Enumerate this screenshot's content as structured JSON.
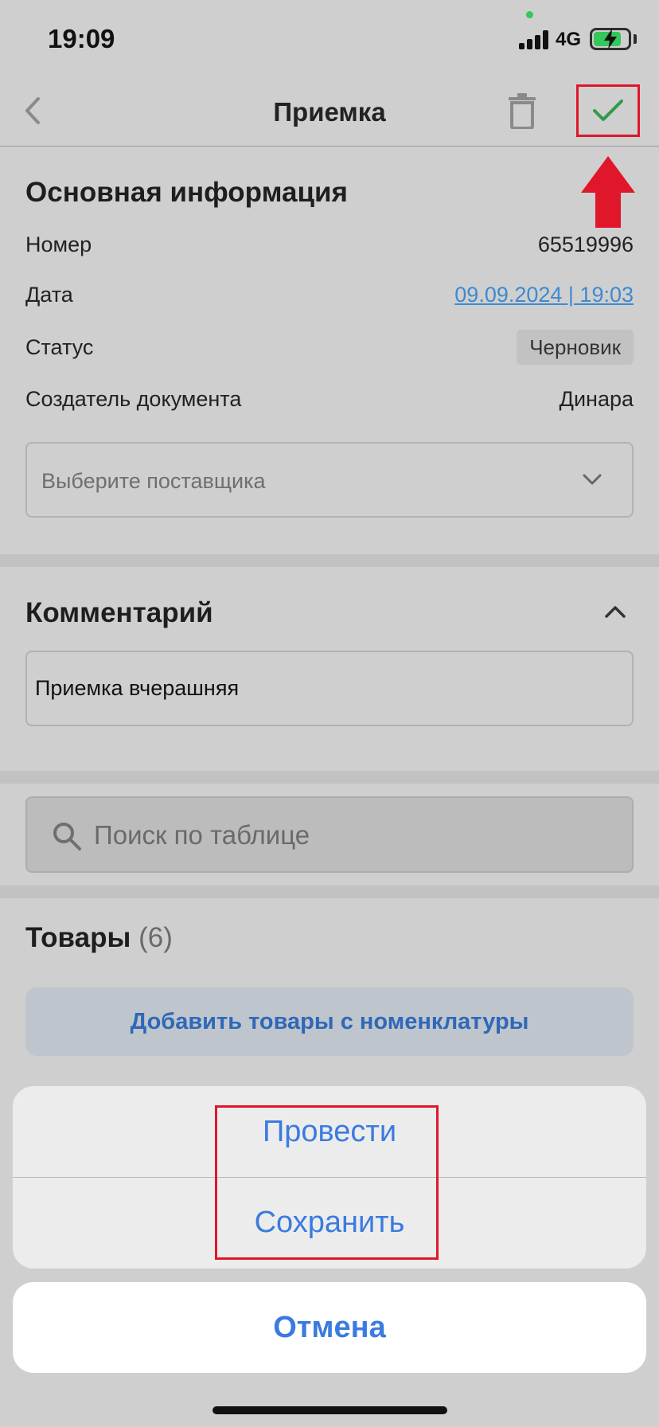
{
  "status_bar": {
    "time": "19:09",
    "network": "4G",
    "icons": [
      "signal-icon",
      "battery-charging-icon"
    ]
  },
  "header": {
    "title": "Приемка",
    "back_icon": "chevron-left-icon",
    "delete_icon": "trash-icon",
    "confirm_icon": "checkmark-icon"
  },
  "main_info": {
    "title": "Основная информация",
    "number_label": "Номер",
    "number_value": "65519996",
    "date_label": "Дата",
    "date_value": "09.09.2024 | 19:03",
    "status_label": "Статус",
    "status_value": "Черновик",
    "creator_label": "Создатель документа",
    "creator_value": "Динара",
    "supplier_placeholder": "Выберите поставщика"
  },
  "comment": {
    "title": "Комментарий",
    "text": "Приемка вчерашняя"
  },
  "search": {
    "placeholder": "Поиск по таблице"
  },
  "goods": {
    "title": "Товары",
    "count": "(6)",
    "add_button": "Добавить товары с номенклатуры"
  },
  "action_sheet": {
    "actions": [
      "Провести",
      "Сохранить"
    ],
    "cancel": "Отмена"
  },
  "colors": {
    "accent_blue": "#3a7be0",
    "link_blue": "#3d8ad0",
    "annotation_red": "#e0162b",
    "check_green": "#2e9c4a"
  }
}
